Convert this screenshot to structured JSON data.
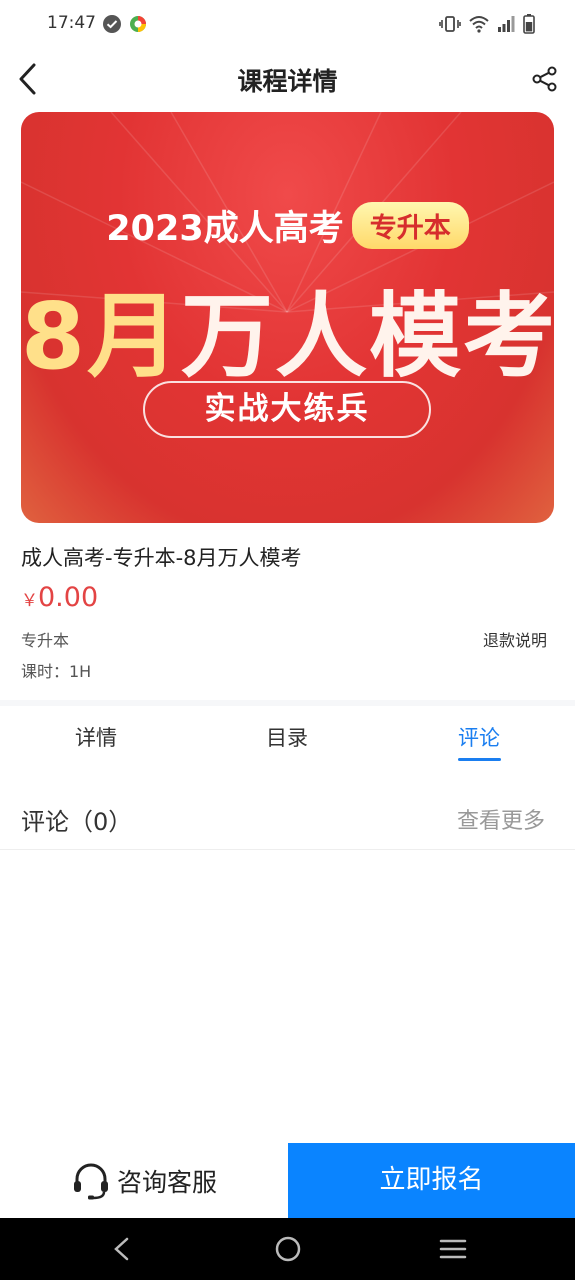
{
  "status_bar": {
    "time": "17:47",
    "left_icons": [
      "check-circle-icon",
      "app-colorful-icon"
    ],
    "right_icons": [
      "vibrate-icon",
      "wifi-icon",
      "signal-icon",
      "battery-icon"
    ]
  },
  "header": {
    "title": "课程详情",
    "back_icon": "back-arrow-icon",
    "share_icon": "share-icon"
  },
  "banner": {
    "year_text": "2023成人高考",
    "badge": "专升本",
    "main_gold": "8月",
    "main_white": "万人模考",
    "pill": "实战大练兵",
    "colors": {
      "background": "#e23434",
      "badge_bg": "#ffe07a",
      "gold": "#ffe08a"
    }
  },
  "course": {
    "title": "成人高考-专升本-8月万人模考",
    "price_symbol": "￥",
    "price": "0.00",
    "tag": "专升本",
    "refund": "退款说明",
    "hours": "课时：1H"
  },
  "tabs": {
    "items": [
      "详情",
      "目录",
      "评论"
    ],
    "active_index": 2,
    "active_color": "#1a7ef0"
  },
  "comments": {
    "title": "评论（0）",
    "view_more": "查看更多"
  },
  "bottom_bar": {
    "consult_label": "咨询客服",
    "consult_icon": "headset-icon",
    "enroll_label": "立即报名",
    "enroll_color": "#0a84ff"
  },
  "nav_bar": {
    "icons": [
      "nav-back-icon",
      "nav-home-icon",
      "nav-menu-icon"
    ]
  }
}
